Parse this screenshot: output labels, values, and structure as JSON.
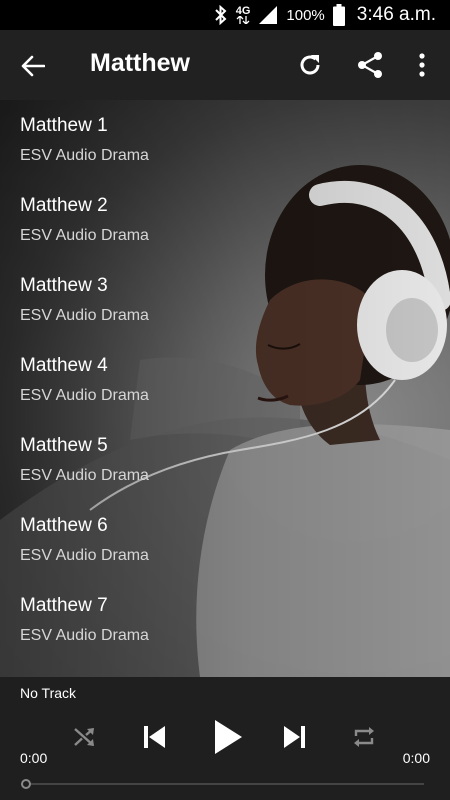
{
  "status_bar": {
    "network": "4G",
    "battery": "100%",
    "time": "3:46 a.m."
  },
  "app_bar": {
    "title": "Matthew",
    "icons": [
      "arrow-back-icon",
      "refresh-icon",
      "share-icon",
      "more-vert-icon"
    ]
  },
  "tracks": [
    {
      "title": "Matthew 1",
      "subtitle": "ESV Audio Drama"
    },
    {
      "title": "Matthew 2",
      "subtitle": "ESV Audio Drama"
    },
    {
      "title": "Matthew 3",
      "subtitle": "ESV Audio Drama"
    },
    {
      "title": "Matthew 4",
      "subtitle": "ESV Audio Drama"
    },
    {
      "title": "Matthew 5",
      "subtitle": "ESV Audio Drama"
    },
    {
      "title": "Matthew 6",
      "subtitle": "ESV Audio Drama"
    },
    {
      "title": "Matthew 7",
      "subtitle": "ESV Audio Drama"
    }
  ],
  "player": {
    "now_playing": "No Track",
    "elapsed": "0:00",
    "duration": "0:00",
    "progress": 0,
    "icons": [
      "shuffle-icon",
      "skip-previous-icon",
      "play-icon",
      "skip-next-icon",
      "repeat-icon"
    ]
  },
  "colors": {
    "status_bar": "#000000",
    "app_bar": "#212121",
    "player_bar": "#1f1f1f",
    "disabled_icon": "#8a8a8a"
  }
}
